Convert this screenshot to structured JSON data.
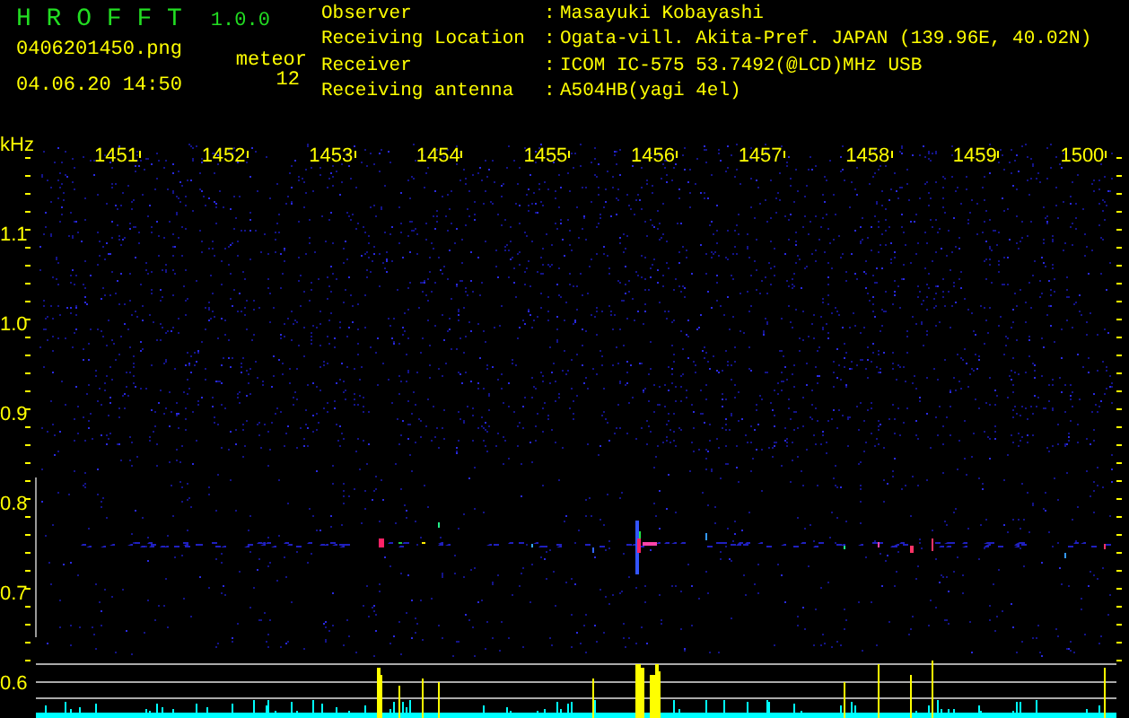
{
  "app": {
    "title": "H R O F F T",
    "version": "1.0.0"
  },
  "file": {
    "filename": "0406201450.png",
    "datetime": "04.06.20 14:50"
  },
  "counter": {
    "label": "meteor",
    "value": "12"
  },
  "info": [
    {
      "label": "Observer",
      "separator": ":",
      "value": "Masayuki Kobayashi"
    },
    {
      "label": "Receiving Location",
      "separator": ":",
      "value": "Ogata-vill. Akita-Pref. JAPAN (139.96E, 40.02N)"
    },
    {
      "label": "Receiver",
      "separator": ":",
      "value": "ICOM IC-575 53.7492(@LCD)MHz USB"
    },
    {
      "label": "Receiving antenna",
      "separator": ":",
      "value": "A504HB(yagi 4el)"
    }
  ],
  "plot": {
    "unit": "kHz",
    "time_labels": [
      "1451",
      "1452",
      "1453",
      "1454",
      "1455",
      "1456",
      "1457",
      "1458",
      "1459",
      "1500"
    ],
    "freq_labels": [
      "1.1",
      "1.0",
      "0.9",
      "0.8",
      "0.7",
      "0.6"
    ]
  }
}
